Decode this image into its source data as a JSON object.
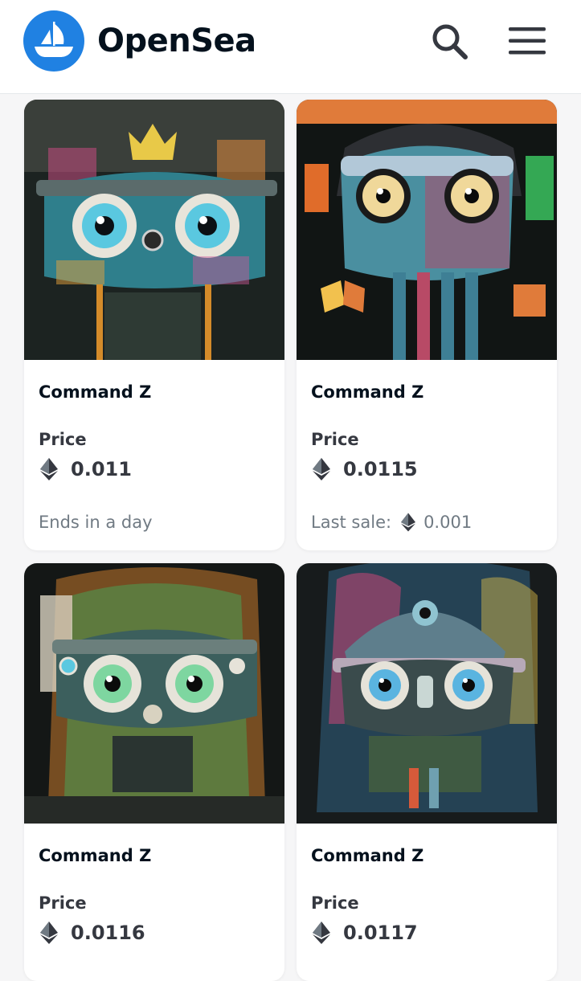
{
  "header": {
    "brand": "OpenSea",
    "logo_icon": "opensea-logo-icon",
    "search_icon": "search-icon",
    "menu_icon": "hamburger-menu-icon",
    "accent": "#2081e2"
  },
  "cards": [
    {
      "title": "Command Z",
      "price_label": "Price",
      "price": "0.011",
      "footer": "Ends in a day",
      "footer_value": ""
    },
    {
      "title": "Command Z",
      "price_label": "Price",
      "price": "0.0115",
      "footer": "Last sale:",
      "footer_value": "0.001"
    },
    {
      "title": "Command Z",
      "price_label": "Price",
      "price": "0.0116",
      "footer": "",
      "footer_value": ""
    },
    {
      "title": "Command Z",
      "price_label": "Price",
      "price": "0.0117",
      "footer": "",
      "footer_value": ""
    }
  ]
}
